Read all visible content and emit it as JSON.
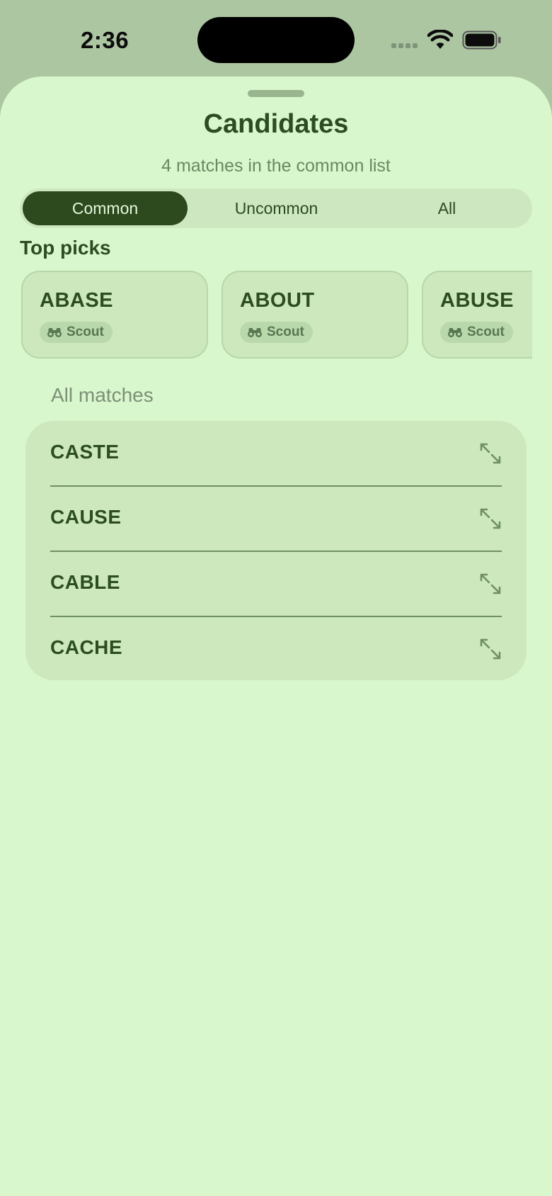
{
  "status": {
    "time": "2:36"
  },
  "sheet": {
    "title": "Candidates",
    "subtitle": "4 matches in the common list"
  },
  "segments": [
    {
      "label": "Common",
      "selected": true
    },
    {
      "label": "Uncommon",
      "selected": false
    },
    {
      "label": "All",
      "selected": false
    }
  ],
  "top_picks": {
    "title": "Top picks",
    "items": [
      {
        "word": "ABASE",
        "badge": "Scout",
        "badge_icon": "binoculars-icon"
      },
      {
        "word": "ABOUT",
        "badge": "Scout",
        "badge_icon": "binoculars-icon"
      },
      {
        "word": "ABUSE",
        "badge": "Scout",
        "badge_icon": "binoculars-icon"
      }
    ]
  },
  "all_matches": {
    "title": "All matches",
    "items": [
      {
        "word": "CASTE",
        "icon": "expand-icon"
      },
      {
        "word": "CAUSE",
        "icon": "expand-icon"
      },
      {
        "word": "CABLE",
        "icon": "expand-icon"
      },
      {
        "word": "CACHE",
        "icon": "expand-icon"
      }
    ]
  },
  "colors": {
    "background": "#d9f7cc",
    "accent": "#2c4a1e",
    "text": "#2c4d21",
    "muted": "#6b8864"
  }
}
